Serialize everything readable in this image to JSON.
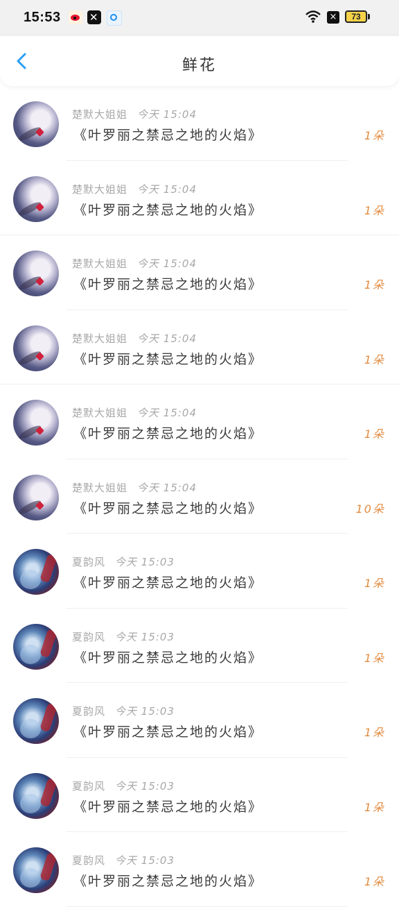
{
  "status_bar": {
    "time": "15:53",
    "battery": "73",
    "apps": [
      "weibo-icon",
      "capcut-icon",
      "blue-app-icon"
    ],
    "accent_battery": "#f6d24a"
  },
  "header": {
    "title": "鲜花",
    "back_icon": "chevron-left-icon",
    "back_color": "#2a9ef3"
  },
  "flowers": [
    {
      "user": "楚默大姐姐",
      "time": "今天 15:04",
      "book": "《叶罗丽之禁忌之地的火焰》",
      "count": "1朵",
      "avatar": "a"
    },
    {
      "user": "楚默大姐姐",
      "time": "今天 15:04",
      "book": "《叶罗丽之禁忌之地的火焰》",
      "count": "1朵",
      "avatar": "a"
    },
    {
      "user": "楚默大姐姐",
      "time": "今天 15:04",
      "book": "《叶罗丽之禁忌之地的火焰》",
      "count": "1朵",
      "avatar": "a"
    },
    {
      "user": "楚默大姐姐",
      "time": "今天 15:04",
      "book": "《叶罗丽之禁忌之地的火焰》",
      "count": "1朵",
      "avatar": "a"
    },
    {
      "user": "楚默大姐姐",
      "time": "今天 15:04",
      "book": "《叶罗丽之禁忌之地的火焰》",
      "count": "1朵",
      "avatar": "a"
    },
    {
      "user": "楚默大姐姐",
      "time": "今天 15:04",
      "book": "《叶罗丽之禁忌之地的火焰》",
      "count": "10朵",
      "avatar": "a"
    },
    {
      "user": "夏韵风",
      "time": "今天 15:03",
      "book": "《叶罗丽之禁忌之地的火焰》",
      "count": "1朵",
      "avatar": "b"
    },
    {
      "user": "夏韵风",
      "time": "今天 15:03",
      "book": "《叶罗丽之禁忌之地的火焰》",
      "count": "1朵",
      "avatar": "b"
    },
    {
      "user": "夏韵风",
      "time": "今天 15:03",
      "book": "《叶罗丽之禁忌之地的火焰》",
      "count": "1朵",
      "avatar": "b"
    },
    {
      "user": "夏韵风",
      "time": "今天 15:03",
      "book": "《叶罗丽之禁忌之地的火焰》",
      "count": "1朵",
      "avatar": "b"
    },
    {
      "user": "夏韵风",
      "time": "今天 15:03",
      "book": "《叶罗丽之禁忌之地的火焰》",
      "count": "1朵",
      "avatar": "b"
    }
  ],
  "colors": {
    "count": "#e38b3f",
    "meta": "#a8a8a8",
    "content": "#3a3a3a"
  }
}
